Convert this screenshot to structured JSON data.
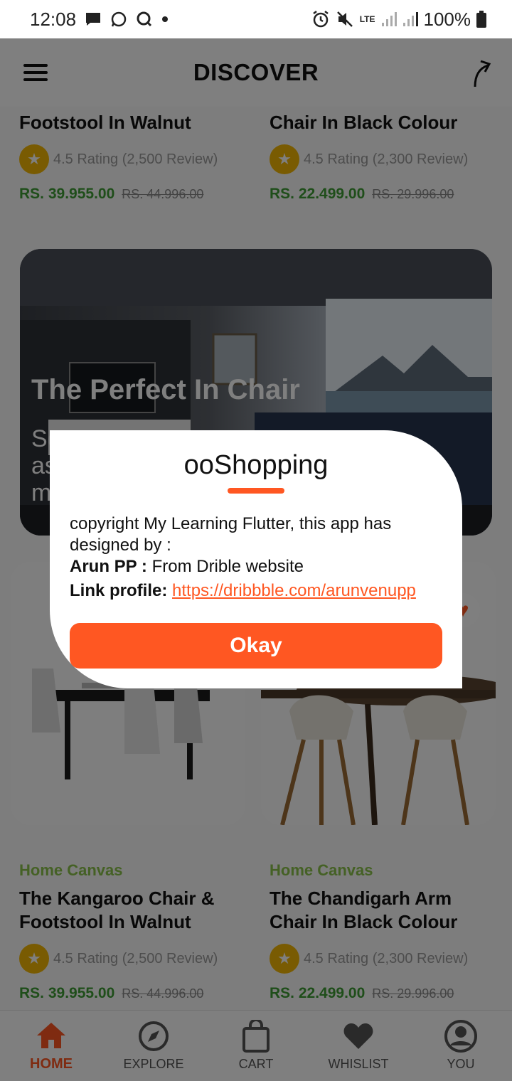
{
  "status": {
    "time": "12:08",
    "battery": "100%",
    "network": "LTE",
    "icons": [
      "chat-icon",
      "whatsapp-icon",
      "q-icon",
      "dot-icon",
      "alarm-icon",
      "mute-icon",
      "lte-icon",
      "signal-icon",
      "signal-icon-2",
      "battery-icon"
    ]
  },
  "header": {
    "title": "DISCOVER",
    "menu_icon": "hamburger-icon",
    "share_icon": "share-arrow-icon"
  },
  "top_products": [
    {
      "name": "Footstool In Walnut",
      "rating": "4.5 Rating (2,500 Review)",
      "price": "RS. 39.955.00",
      "old_price": "RS. 44.996.00"
    },
    {
      "name": "Chair In Black Colour",
      "rating": "4.5 Rating (2,300 Review)",
      "price": "RS. 22.499.00",
      "old_price": "RS. 29.996.00"
    }
  ],
  "banner": {
    "title": "The Perfect In Chair",
    "subtitle_fragment": "Se\nas\nm"
  },
  "products": [
    {
      "brand": "Home Canvas",
      "name": "The Kangaroo Chair & Footstool In Walnut",
      "rating": "4.5 Rating (2,500 Review)",
      "price": "RS. 39.955.00",
      "old_price": "RS. 44.996.00"
    },
    {
      "brand": "Home Canvas",
      "name": "The Chandigarh Arm Chair In Black Colour",
      "rating": "4.5 Rating (2,300 Review)",
      "price": "RS. 22.499.00",
      "old_price": "RS. 29.996.00"
    }
  ],
  "dialog": {
    "title": "ooShopping",
    "line1": "copyright My Learning Flutter, this app has designed by :",
    "author_label": "Arun PP :",
    "author_value": " From Drible website",
    "link_label": "Link profile:",
    "link_url": "https://dribbble.com/arunvenupp",
    "button": "Okay"
  },
  "bottom_nav": [
    {
      "label": "HOME",
      "icon": "home-icon",
      "active": true
    },
    {
      "label": "EXPLORE",
      "icon": "compass-icon",
      "active": false
    },
    {
      "label": "CART",
      "icon": "shopping-bag-icon",
      "active": false
    },
    {
      "label": "WHISLIST",
      "icon": "heart-icon",
      "active": false
    },
    {
      "label": "YOU",
      "icon": "account-icon",
      "active": false
    }
  ],
  "colors": {
    "accent": "#ff5722",
    "price_green": "#3e9c35",
    "brand_green": "#8bc34a",
    "star_yellow": "#f2b705"
  }
}
